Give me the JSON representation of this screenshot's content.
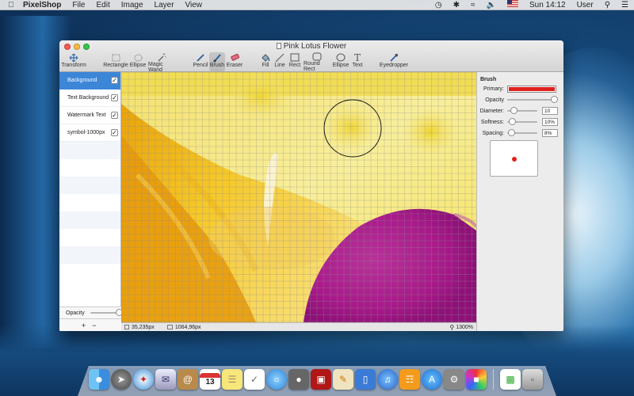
{
  "menubar": {
    "app": "PixelShop",
    "items": [
      "File",
      "Edit",
      "Image",
      "Layer",
      "View"
    ],
    "clock": "Sun 14:12",
    "user": "User"
  },
  "window": {
    "title": "Pink Lotus Flower"
  },
  "toolbar": {
    "tools": [
      "Transform",
      "Rectangle",
      "Ellipse",
      "Magic Wand",
      "Pencil",
      "Brush",
      "Eraser",
      "Fill",
      "Line",
      "Rect",
      "Round Rect",
      "Ellipse",
      "Text",
      "Eyedropper"
    ],
    "active": "Brush"
  },
  "layers": {
    "items": [
      {
        "name": "Background",
        "visible": true,
        "selected": true
      },
      {
        "name": "Text Background",
        "visible": true,
        "selected": false
      },
      {
        "name": "Watermark Text",
        "visible": true,
        "selected": false
      },
      {
        "name": "symbol-1000px",
        "visible": true,
        "selected": false
      }
    ],
    "opacity_label": "Opacity",
    "opacity_value": 1.0,
    "add_label": "+",
    "remove_label": "−"
  },
  "status": {
    "cursor": "35,235px",
    "size": "1064,96px",
    "zoom": "1300%"
  },
  "brush_panel": {
    "title": "Brush",
    "primary_label": "Primary:",
    "primary_color": "#e0201c",
    "opacity_label": "Opacity",
    "opacity_value": 1.0,
    "diameter_label": "Diameter:",
    "diameter_value": "10",
    "softness_label": "Softness:",
    "softness_value": "10%",
    "spacing_label": "Spacing:",
    "spacing_value": "8%"
  },
  "colors": {
    "selection": "#3c86d8",
    "magenta": "#b0208e",
    "yellow": "#f2de3c"
  },
  "dock": {
    "icons": [
      "finder-icon",
      "launchpad-icon",
      "safari-icon",
      "mail-icon",
      "contacts-icon",
      "calendar-icon",
      "notes-icon",
      "reminders-icon",
      "messages-icon",
      "facetime-icon",
      "photo-booth-icon",
      "pages-icon",
      "keynote-icon",
      "itunes-icon",
      "ibooks-icon",
      "app-store-icon",
      "system-preferences-icon",
      "pixelshop-icon",
      "documents-icon",
      "trash-icon"
    ],
    "calendar_day": "13"
  }
}
